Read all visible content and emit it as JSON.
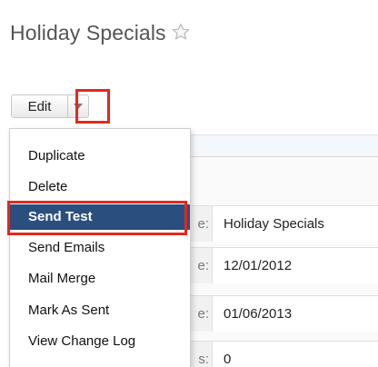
{
  "header": {
    "title": "Holiday Specials",
    "favorite_icon": "star-icon"
  },
  "actions": {
    "edit_label": "Edit",
    "dropdown_icon": "caret-down-icon"
  },
  "menu": {
    "items": [
      {
        "label": "Duplicate"
      },
      {
        "label": "Delete"
      },
      {
        "label": "Send Test",
        "active": true
      },
      {
        "label": "Send Emails"
      },
      {
        "label": "Mail Merge"
      },
      {
        "label": "Mark As Sent"
      },
      {
        "label": "View Change Log"
      }
    ]
  },
  "record": {
    "fields": [
      {
        "label_fragment": "e:",
        "value": "Holiday Specials"
      },
      {
        "label_fragment": "e:",
        "value": "12/01/2012"
      },
      {
        "label_fragment": "e:",
        "value": "01/06/2013"
      },
      {
        "label_fragment": "s:",
        "value": "0"
      }
    ]
  },
  "colors": {
    "highlight": "#e5281a",
    "menu_active_bg": "#2a4f7e",
    "title": "#555555"
  }
}
